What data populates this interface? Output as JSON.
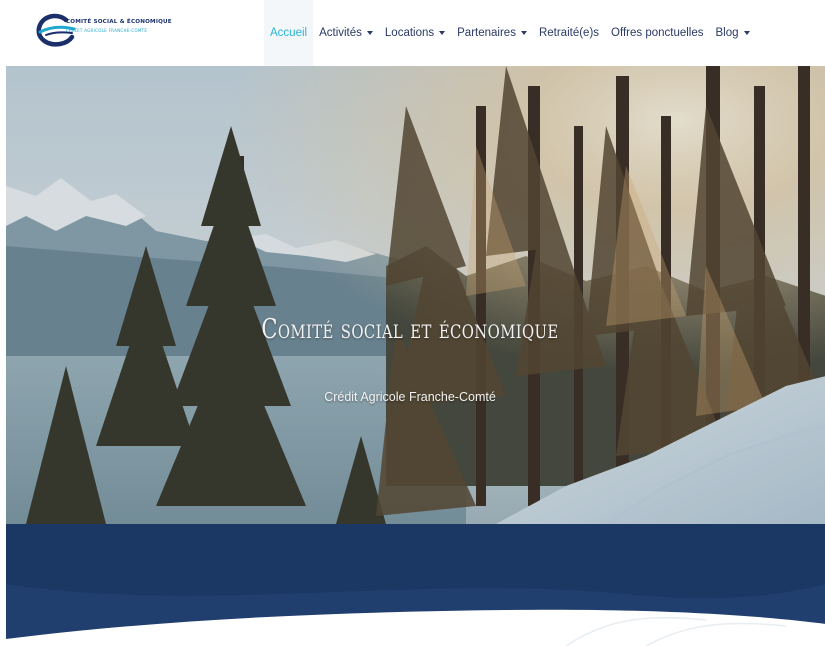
{
  "logo": {
    "title": "COMITÉ SOCIAL & ÉCONOMIQUE",
    "subtitle": "CRÉDIT AGRICOLE FRANCHE-COMTÉ"
  },
  "nav": {
    "items": [
      {
        "label": "Accueil",
        "active": true,
        "dropdown": false
      },
      {
        "label": "Activités",
        "active": false,
        "dropdown": true
      },
      {
        "label": "Locations",
        "active": false,
        "dropdown": true
      },
      {
        "label": "Partenaires",
        "active": false,
        "dropdown": true
      },
      {
        "label": "Retraité(e)s",
        "active": false,
        "dropdown": false
      },
      {
        "label": "Offres ponctuelles",
        "active": false,
        "dropdown": false
      },
      {
        "label": "Blog",
        "active": false,
        "dropdown": true
      }
    ]
  },
  "hero": {
    "title": "Comité social et économique",
    "subtitle": "Crédit Agricole Franche-Comté",
    "image": "winter-forest-mountain-landscape"
  },
  "colors": {
    "brand_navy": "#1b3763",
    "accent_cyan": "#2bb3d6",
    "nav_text": "#2a3a66"
  }
}
